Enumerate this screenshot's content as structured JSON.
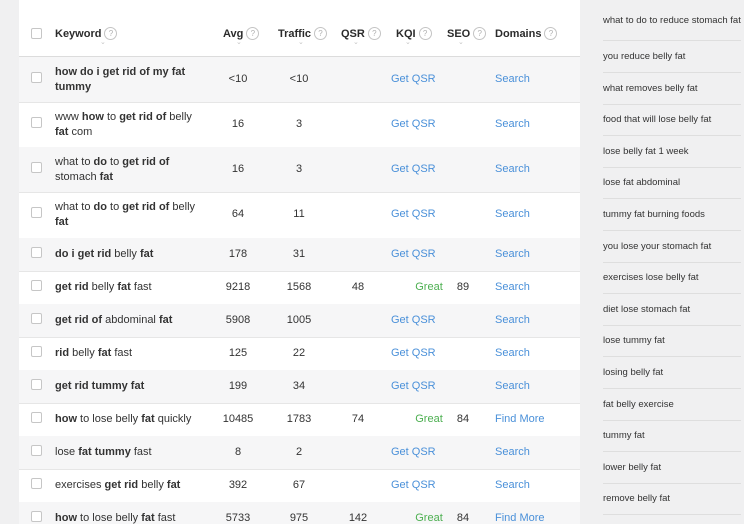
{
  "table": {
    "headers": {
      "keyword": "Keyword",
      "avg": "Avg",
      "traffic": "Traffic",
      "qsr": "QSR",
      "kqi": "KQI",
      "seo": "SEO",
      "domains": "Domains"
    },
    "info_glyph": "?",
    "caret_glyph": "⌄",
    "rows": [
      {
        "keyword_html": "<b>how do i get rid of my fat tummy</b>",
        "avg": "<10",
        "traffic": "<10",
        "qsr": "",
        "kqi": "Get QSR",
        "seo": "",
        "domains": "Search"
      },
      {
        "keyword_html": "www <b>how</b> to <b>get rid of</b> belly <b>fat</b> com",
        "avg": "16",
        "traffic": "3",
        "qsr": "",
        "kqi": "Get QSR",
        "seo": "",
        "domains": "Search"
      },
      {
        "keyword_html": "what to <b>do</b> to <b>get rid of</b> stomach <b>fat</b>",
        "avg": "16",
        "traffic": "3",
        "qsr": "",
        "kqi": "Get QSR",
        "seo": "",
        "domains": "Search"
      },
      {
        "keyword_html": "what to <b>do</b> to <b>get rid of</b> belly <b>fat</b>",
        "avg": "64",
        "traffic": "11",
        "qsr": "",
        "kqi": "Get QSR",
        "seo": "",
        "domains": "Search"
      },
      {
        "keyword_html": "<b>do i get rid</b> belly <b>fat</b>",
        "avg": "178",
        "traffic": "31",
        "qsr": "",
        "kqi": "Get QSR",
        "seo": "",
        "domains": "Search"
      },
      {
        "keyword_html": "<b>get rid</b> belly <b>fat</b> fast",
        "avg": "9218",
        "traffic": "1568",
        "qsr": "48",
        "kqi": "Great",
        "seo": "89",
        "domains": "Search"
      },
      {
        "keyword_html": "<b>get rid of</b> abdominal <b>fat</b>",
        "avg": "5908",
        "traffic": "1005",
        "qsr": "",
        "kqi": "Get QSR",
        "seo": "",
        "domains": "Search"
      },
      {
        "keyword_html": "<b>rid</b> belly <b>fat</b> fast",
        "avg": "125",
        "traffic": "22",
        "qsr": "",
        "kqi": "Get QSR",
        "seo": "",
        "domains": "Search"
      },
      {
        "keyword_html": "<b>get rid tummy fat</b>",
        "avg": "199",
        "traffic": "34",
        "qsr": "",
        "kqi": "Get QSR",
        "seo": "",
        "domains": "Search"
      },
      {
        "keyword_html": "<b>how</b> to lose belly <b>fat</b> quickly",
        "avg": "10485",
        "traffic": "1783",
        "qsr": "74",
        "kqi": "Great",
        "seo": "84",
        "domains": "Find More"
      },
      {
        "keyword_html": "lose <b>fat tummy</b> fast",
        "avg": "8",
        "traffic": "2",
        "qsr": "",
        "kqi": "Get QSR",
        "seo": "",
        "domains": "Search"
      },
      {
        "keyword_html": "exercises <b>get rid</b> belly <b>fat</b>",
        "avg": "392",
        "traffic": "67",
        "qsr": "",
        "kqi": "Get QSR",
        "seo": "",
        "domains": "Search"
      },
      {
        "keyword_html": "<b>how</b> to lose belly <b>fat</b> fast",
        "avg": "5733",
        "traffic": "975",
        "qsr": "142",
        "kqi": "Great",
        "seo": "84",
        "domains": "Find More"
      }
    ]
  },
  "sidebar": {
    "items": [
      "what to do to reduce stomach fat",
      "you reduce belly fat",
      "what removes belly fat",
      "food that will lose belly fat",
      "lose belly fat 1 week",
      "lose fat abdominal",
      "tummy fat burning foods",
      "you lose your stomach fat",
      "exercises lose belly fat",
      "diet lose stomach fat",
      "lose tummy fat",
      "losing belly fat",
      "fat belly exercise",
      "tummy fat",
      "lower belly fat",
      "remove belly fat"
    ]
  },
  "colors": {
    "link": "#4a90d9",
    "great": "#4caf50",
    "row_alt": "#f6f6f7",
    "page_bg": "#f0f0f1"
  }
}
